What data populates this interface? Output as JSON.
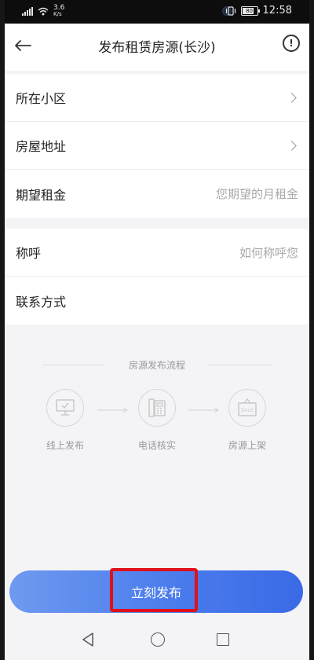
{
  "status_bar": {
    "network_speed": "3.6",
    "network_unit": "K/s",
    "battery_level": "80",
    "time": "12:58"
  },
  "header": {
    "title": "发布租赁房源(长沙)"
  },
  "form": {
    "community_label": "所在小区",
    "address_label": "房屋地址",
    "rent_label": "期望租金",
    "rent_placeholder": "您期望的月租金",
    "name_label": "称呼",
    "name_placeholder": "如何称呼您",
    "contact_label": "联系方式"
  },
  "process": {
    "title": "房源发布流程",
    "steps": [
      {
        "label": "线上发布",
        "icon": "computer-icon"
      },
      {
        "label": "电话核实",
        "icon": "telephone-icon"
      },
      {
        "label": "房源上架",
        "icon": "sale-sign-icon"
      }
    ],
    "sale_text": "SALE"
  },
  "publish_button": {
    "label": "立刻发布"
  },
  "colors": {
    "accent_start": "#6f9af0",
    "accent_end": "#3a6ae6",
    "highlight": "#e0101a"
  }
}
